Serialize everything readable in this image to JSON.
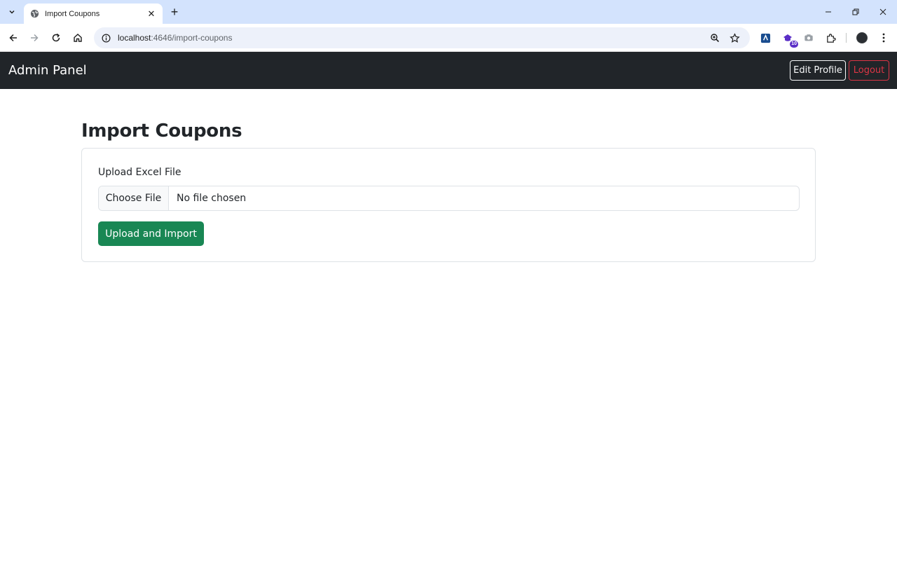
{
  "browser": {
    "tab_title": "Import Coupons",
    "url_host": "localhost",
    "url_rest": ":4646/import-coupons",
    "extension_badge": "10"
  },
  "navbar": {
    "brand": "Admin Panel",
    "edit_profile": "Edit Profile",
    "logout": "Logout"
  },
  "page": {
    "title": "Import Coupons",
    "form": {
      "label": "Upload Excel File",
      "file_button": "Choose File",
      "file_status": "No file chosen",
      "submit": "Upload and Import"
    }
  },
  "colors": {
    "navbar_bg": "#212529",
    "submit_bg": "#198754",
    "logout": "#dc3545",
    "tabstrip": "#d3e3fd"
  }
}
